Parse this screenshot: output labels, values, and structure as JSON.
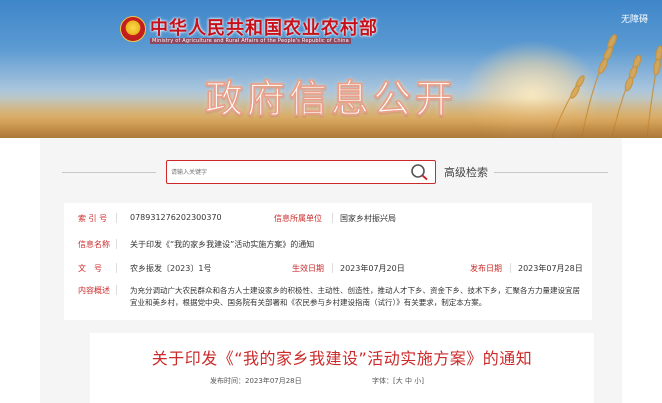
{
  "header": {
    "ministry_name_cn": "中华人民共和国农业农村部",
    "ministry_name_en": "Ministry of Agriculture and Rural Affairs of the People's Republic of China",
    "barrier_free": "无障碍",
    "section_title": "政府信息公开"
  },
  "search": {
    "placeholder": "请输入关键字",
    "advanced_label": "高级检索"
  },
  "info": {
    "index_label": "索 引 号",
    "index_value": "078931276202300370",
    "org_label": "信息所属单位",
    "org_value": "国家乡村振兴局",
    "name_label": "信息名称",
    "name_value": "关于印发《“我的家乡我建设”活动实施方案》的通知",
    "doc_label": "文　号",
    "doc_value": "农乡振发〔2023〕1号",
    "effective_label": "生效日期",
    "effective_value": "2023年07月20日",
    "publish_label": "发布日期",
    "publish_value": "2023年07月28日",
    "summary_label": "内容概述",
    "summary_value": "为充分调动广大农民群众和各方人士建设家乡的积极性、主动性、创造性，推动人才下乡、资金下乡、技术下乡，汇聚各方力量建设宜居宜业和美乡村，根据党中央、国务院有关部署和《农民参与乡村建设指南（试行）》有关要求，制定本方案。"
  },
  "article": {
    "title": "关于印发《“我的家乡我建设”活动实施方案》的通知",
    "publish_time": "发布时间：2023年07月28日",
    "font_label": "字体：[",
    "font_large": "大",
    "font_medium": "中",
    "font_small": "小",
    "font_close": "]"
  },
  "colors": {
    "accent": "#cc2a2a",
    "banner_blue": "#4a8fcd"
  }
}
